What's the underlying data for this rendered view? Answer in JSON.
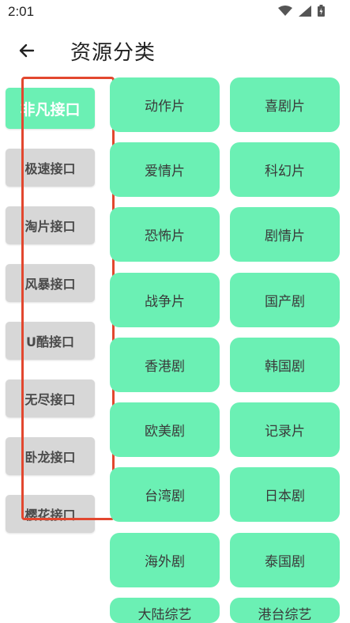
{
  "status": {
    "time": "2:01"
  },
  "appbar": {
    "title": "资源分类"
  },
  "sidebar": {
    "items": [
      {
        "label": "非凡接口"
      },
      {
        "label": "极速接口"
      },
      {
        "label": "淘片接口"
      },
      {
        "label": "风暴接口"
      },
      {
        "label": "U酷接口"
      },
      {
        "label": "无尽接口"
      },
      {
        "label": "卧龙接口"
      },
      {
        "label": "樱花接口"
      }
    ]
  },
  "categories": [
    {
      "label": "动作片"
    },
    {
      "label": "喜剧片"
    },
    {
      "label": "爱情片"
    },
    {
      "label": "科幻片"
    },
    {
      "label": "恐怖片"
    },
    {
      "label": "剧情片"
    },
    {
      "label": "战争片"
    },
    {
      "label": "国产剧"
    },
    {
      "label": "香港剧"
    },
    {
      "label": "韩国剧"
    },
    {
      "label": "欧美剧"
    },
    {
      "label": "记录片"
    },
    {
      "label": "台湾剧"
    },
    {
      "label": "日本剧"
    },
    {
      "label": "海外剧"
    },
    {
      "label": "泰国剧"
    },
    {
      "label": "大陆综艺"
    },
    {
      "label": "港台综艺"
    }
  ],
  "colors": {
    "accent": "#6bf0b4",
    "inactive": "#d7d7d7",
    "highlight": "#e2472f"
  }
}
